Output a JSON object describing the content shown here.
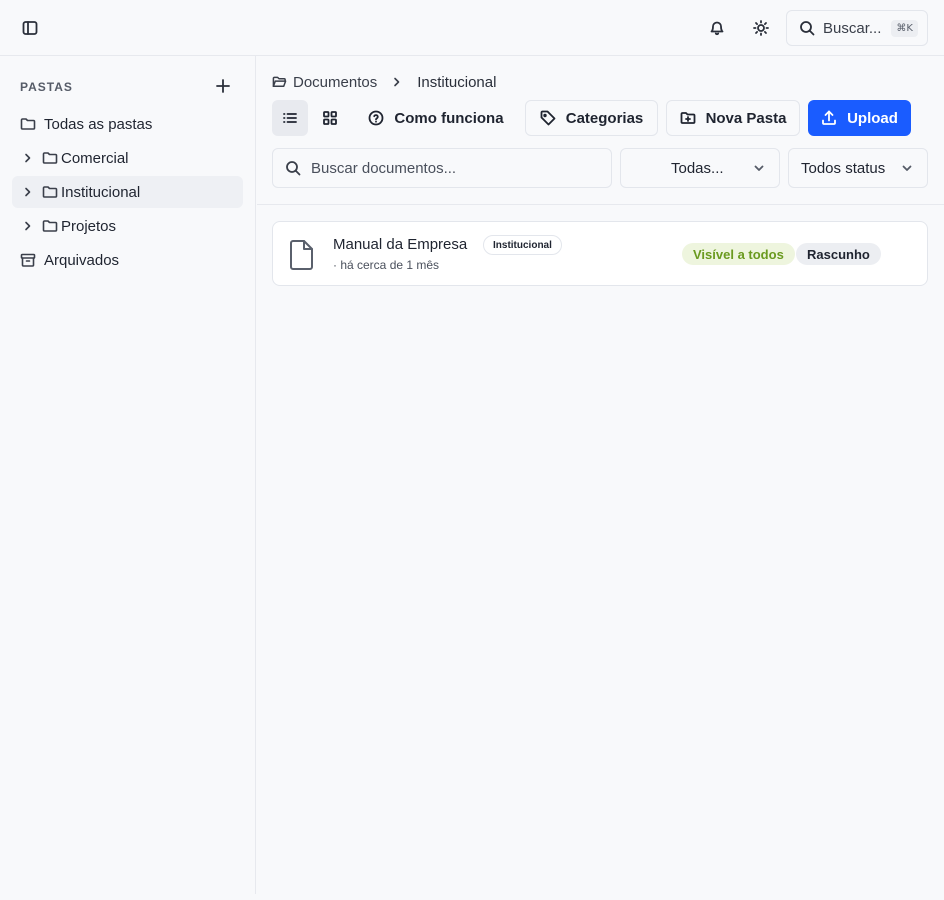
{
  "header": {
    "search_label": "Buscar...",
    "search_shortcut": "⌘K",
    "icons": [
      "sidebar-toggle-icon",
      "bell-icon",
      "sun-icon",
      "search-icon"
    ]
  },
  "sidebar": {
    "heading": "PASTAS",
    "items": [
      {
        "label": "Todas as pastas",
        "icon": "folder-icon",
        "expandable": false,
        "active": false
      },
      {
        "label": "Comercial",
        "icon": "folder-icon",
        "expandable": true,
        "active": false
      },
      {
        "label": "Institucional",
        "icon": "folder-icon",
        "expandable": true,
        "active": true
      },
      {
        "label": "Projetos",
        "icon": "folder-icon",
        "expandable": true,
        "active": false
      },
      {
        "label": "Arquivados",
        "icon": "archive-icon",
        "expandable": false,
        "active": false
      }
    ]
  },
  "breadcrumb": {
    "root": "Documentos",
    "current": "Institucional"
  },
  "toolbar": {
    "how_it_works": "Como funciona",
    "categories": "Categorias",
    "new_folder": "Nova Pasta",
    "upload": "Upload",
    "active_view": "list"
  },
  "filters": {
    "search_placeholder": "Buscar documentos...",
    "category_value": "Todas...",
    "status_value": "Todos status"
  },
  "documents": [
    {
      "name": "Manual da Empresa",
      "category": "Institucional",
      "meta": "· há cerca de 1 mês",
      "visibility": "Visível a todos",
      "status": "Rascunho"
    }
  ],
  "colors": {
    "accent": "#1a5cff",
    "visible_bg": "#eef5de",
    "visible_text": "#6a9a1f",
    "draft_bg": "#eceef2"
  }
}
